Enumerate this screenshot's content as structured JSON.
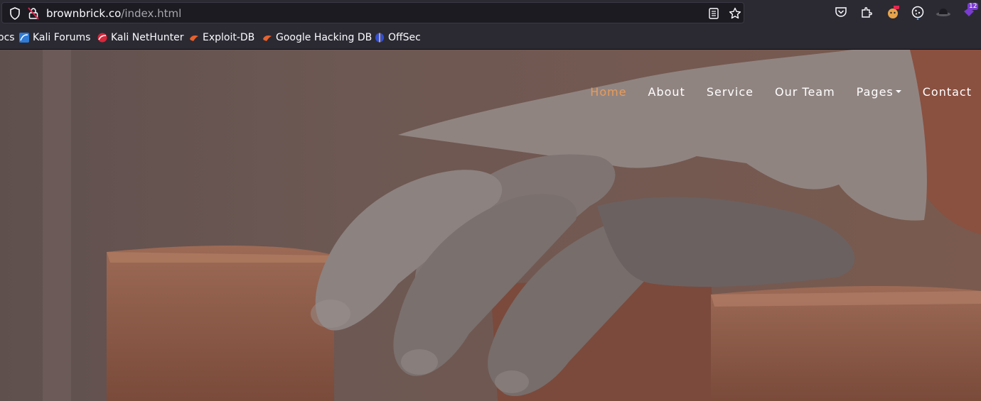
{
  "browser": {
    "url_host": "brownbrick.co",
    "url_path": "/index.html",
    "extension_badge": "12"
  },
  "bookmarks": [
    {
      "label": "ocs"
    },
    {
      "label": "Kali Forums"
    },
    {
      "label": "Kali NetHunter"
    },
    {
      "label": "Exploit-DB"
    },
    {
      "label": "Google Hacking DB"
    },
    {
      "label": "OffSec"
    }
  ],
  "nav": {
    "items": [
      {
        "label": "Home"
      },
      {
        "label": "About"
      },
      {
        "label": "Service"
      },
      {
        "label": "Our Team"
      },
      {
        "label": "Pages"
      },
      {
        "label": "Contact"
      }
    ],
    "active_color": "#e89c5a"
  },
  "hero": {
    "image": "gloved-hand-on-bricks"
  }
}
